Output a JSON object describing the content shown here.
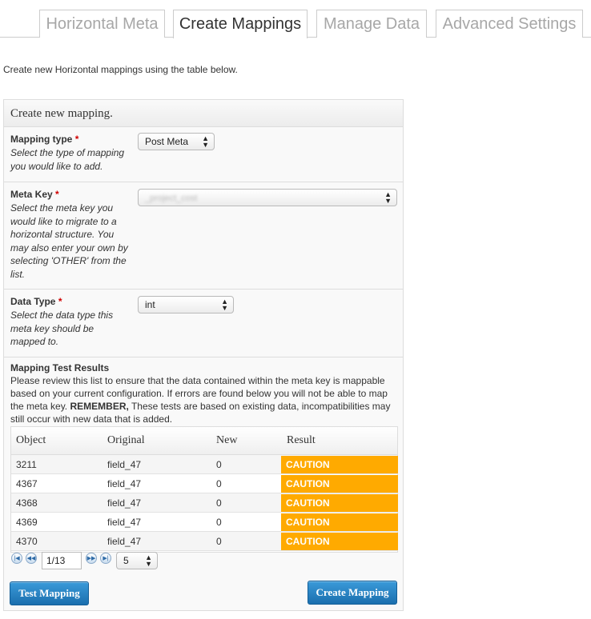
{
  "tabs": [
    {
      "label": "Horizontal Meta",
      "active": false
    },
    {
      "label": "Create Mappings",
      "active": true
    },
    {
      "label": "Manage Data",
      "active": false
    },
    {
      "label": "Advanced Settings",
      "active": false
    }
  ],
  "intro": "Create new Horizontal mappings using the table below.",
  "panel": {
    "title": "Create new mapping.",
    "mapping_type": {
      "label": "Mapping type",
      "required": "*",
      "desc": "Select the type of mapping you would like to add.",
      "value": "Post Meta"
    },
    "meta_key": {
      "label": "Meta Key",
      "required": "*",
      "desc": "Select the meta key you would like to migrate to a horizontal structure. You may also enter your own by selecting 'OTHER' from the list.",
      "value": "_project_cost"
    },
    "data_type": {
      "label": "Data Type",
      "required": "*",
      "desc": "Select the data type this meta key should be mapped to.",
      "value": "int"
    },
    "results": {
      "title": "Mapping Test Results",
      "desc_before": "Please review this list to ensure that the data contained within the meta key is mappable based on your current configuration. If errors are found below you will not be able to map the meta key.",
      "desc_bold": "REMEMBER,",
      "desc_after": "These tests are based on existing data, incompatibilities may still occur with new data that is added."
    }
  },
  "grid": {
    "columns": [
      "Object",
      "Original",
      "New",
      "Result"
    ],
    "rows": [
      {
        "object": "3211",
        "original": "field_47",
        "new": "0",
        "result": "CAUTION"
      },
      {
        "object": "4367",
        "original": "field_47",
        "new": "0",
        "result": "CAUTION"
      },
      {
        "object": "4368",
        "original": "field_47",
        "new": "0",
        "result": "CAUTION"
      },
      {
        "object": "4369",
        "original": "field_47",
        "new": "0",
        "result": "CAUTION"
      },
      {
        "object": "4370",
        "original": "field_47",
        "new": "0",
        "result": "CAUTION"
      }
    ],
    "caution_color": "#ffaa00"
  },
  "pager": {
    "page": "1/13",
    "page_size": "5",
    "icons": [
      "first-page-icon",
      "prev-page-icon",
      "next-page-icon",
      "last-page-icon"
    ]
  },
  "buttons": {
    "test": "Test Mapping",
    "create": "Create Mapping"
  },
  "colors": {
    "button_blue": "#2a86c8",
    "required_red": "#d00000"
  }
}
